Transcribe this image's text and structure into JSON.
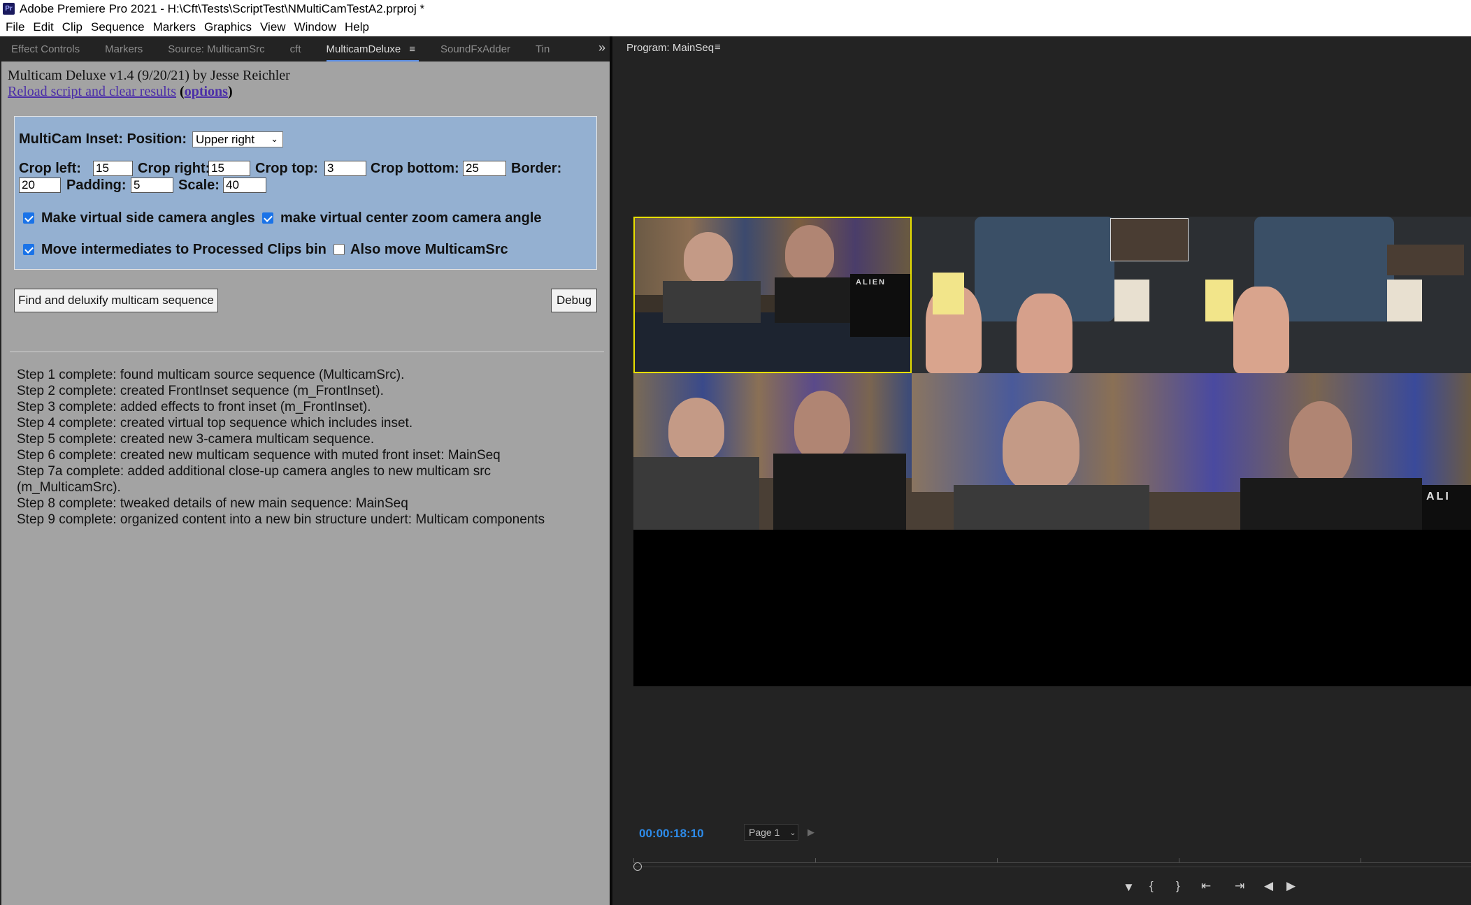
{
  "window": {
    "app_badge": "Pr",
    "title": "Adobe Premiere Pro 2021 - H:\\Cft\\Tests\\ScriptTest\\NMultiCamTestA2.prproj *"
  },
  "menu": [
    "File",
    "Edit",
    "Clip",
    "Sequence",
    "Markers",
    "Graphics",
    "View",
    "Window",
    "Help"
  ],
  "left_tabs": [
    "Effect Controls",
    "Markers",
    "Source: MulticamSrc",
    "cft",
    "MulticamDeluxe",
    "SoundFxAdder",
    "Tin"
  ],
  "active_tab_index": 4,
  "panel_menu_glyph": "≡",
  "overflow_glyph": "»",
  "plugin": {
    "heading": "Multicam Deluxe v1.4 (9/20/21) by Jesse Reichler",
    "reload_link": "Reload script and clear results",
    "options_open": "(",
    "options_link": "options",
    "options_close": ")",
    "inset_label": "MultiCam Inset: Position:",
    "position_value": "Upper right",
    "crop_left_label": "Crop left:",
    "crop_left": "15",
    "crop_right_label": "Crop right:",
    "crop_right": "15",
    "crop_top_label": "Crop top:",
    "crop_top": "3",
    "crop_bottom_label": "Crop bottom:",
    "crop_bottom": "25",
    "border_label": "Border:",
    "border": "20",
    "padding_label": "Padding:",
    "padding": "5",
    "scale_label": "Scale:",
    "scale": "40",
    "cb_side_label": "Make virtual side camera angles",
    "cb_side": true,
    "cb_center_label": "make virtual center zoom camera angle",
    "cb_center": true,
    "cb_move_label": "Move intermediates to Processed Clips bin",
    "cb_move": true,
    "cb_also_label": "Also move MulticamSrc",
    "cb_also": false,
    "find_button": "Find and deluxify multicam sequence",
    "debug_button": "Debug",
    "steps": [
      "Step 1 complete: found multicam source sequence (MulticamSrc).",
      "Step 2 complete: created FrontInset sequence (m_FrontInset).",
      "Step 3 complete: added effects to front inset (m_FrontInset).",
      "Step 4 complete: created virtual top sequence which includes inset.",
      "Step 5 complete: created new 3-camera multicam sequence.",
      "Step 6 complete: created new multicam sequence with muted front inset: MainSeq",
      "Step 7a complete: added additional close-up camera angles to new multicam src (m_MulticamSrc).",
      "Step 8 complete: tweaked details of new main sequence: MainSeq",
      "Step 9 complete: organized content into a new bin structure undert: Multicam components"
    ]
  },
  "program": {
    "tab_label": "Program: MainSeq",
    "timecode": "00:00:18:10",
    "page": "Page 1",
    "frame_text_alien": "ALIEN",
    "frame_text_alien2": "ALI"
  },
  "colors": {
    "accent": "#2d8ceb",
    "active_angle_border": "#e8e000",
    "panel_bg": "#a3a3a3",
    "options_bg": "#94b0d1"
  }
}
